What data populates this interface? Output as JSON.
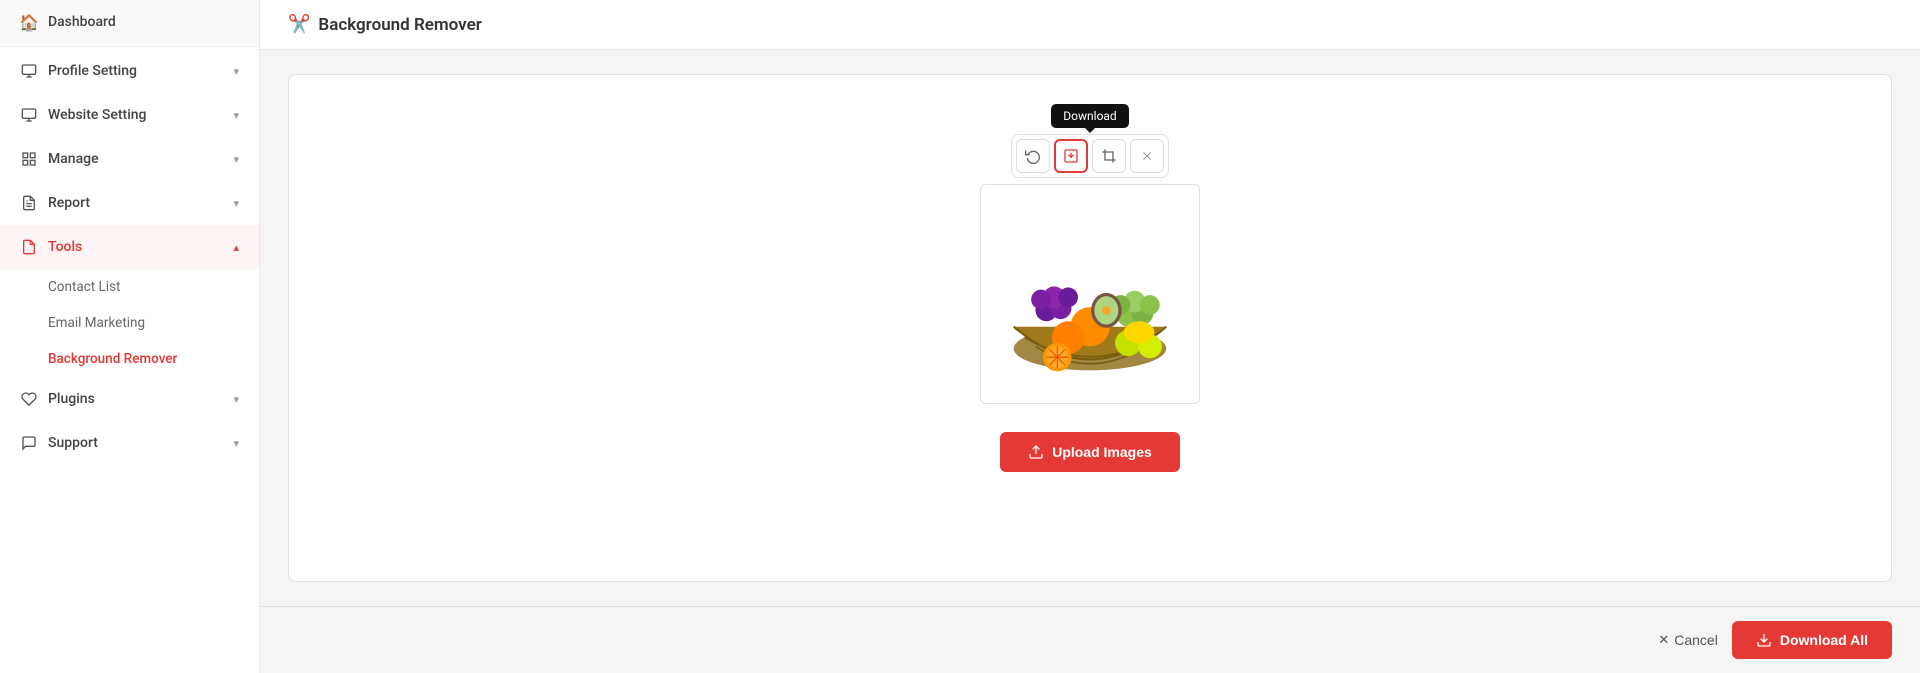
{
  "sidebar": {
    "items": [
      {
        "id": "dashboard",
        "label": "Dashboard",
        "icon": "🏠",
        "hasChevron": false,
        "active": false
      },
      {
        "id": "profile-setting",
        "label": "Profile Setting",
        "icon": "🖥",
        "hasChevron": true,
        "active": false
      },
      {
        "id": "website-setting",
        "label": "Website Setting",
        "icon": "🖥",
        "hasChevron": true,
        "active": false
      },
      {
        "id": "manage",
        "label": "Manage",
        "icon": "▦",
        "hasChevron": true,
        "active": false
      },
      {
        "id": "report",
        "label": "Report",
        "icon": "📄",
        "hasChevron": true,
        "active": false
      },
      {
        "id": "tools",
        "label": "Tools",
        "icon": "📋",
        "hasChevron": true,
        "active": true
      },
      {
        "id": "plugins",
        "label": "Plugins",
        "icon": "🔌",
        "hasChevron": true,
        "active": false
      },
      {
        "id": "support",
        "label": "Support",
        "icon": "💬",
        "hasChevron": true,
        "active": false
      }
    ],
    "sub_items": [
      {
        "id": "contact-list",
        "label": "Contact List",
        "active": false
      },
      {
        "id": "email-marketing",
        "label": "Email Marketing",
        "active": false
      },
      {
        "id": "background-remover",
        "label": "Background Remover",
        "active": true
      }
    ]
  },
  "page": {
    "title": "Background Remover",
    "icon": "✂️"
  },
  "toolbar": {
    "download_tooltip": "Download",
    "btn_rotate": "↻",
    "btn_download": "⬇",
    "btn_crop": "⛶",
    "btn_close": "✕"
  },
  "upload": {
    "label": "Upload Images",
    "icon": "⬆"
  },
  "bottom": {
    "cancel_label": "Cancel",
    "download_all_label": "Download All"
  },
  "colors": {
    "accent": "#e53935",
    "active_bg": "#fff5f5",
    "sidebar_bg": "#ffffff",
    "text_primary": "#333333",
    "text_secondary": "#666666"
  }
}
